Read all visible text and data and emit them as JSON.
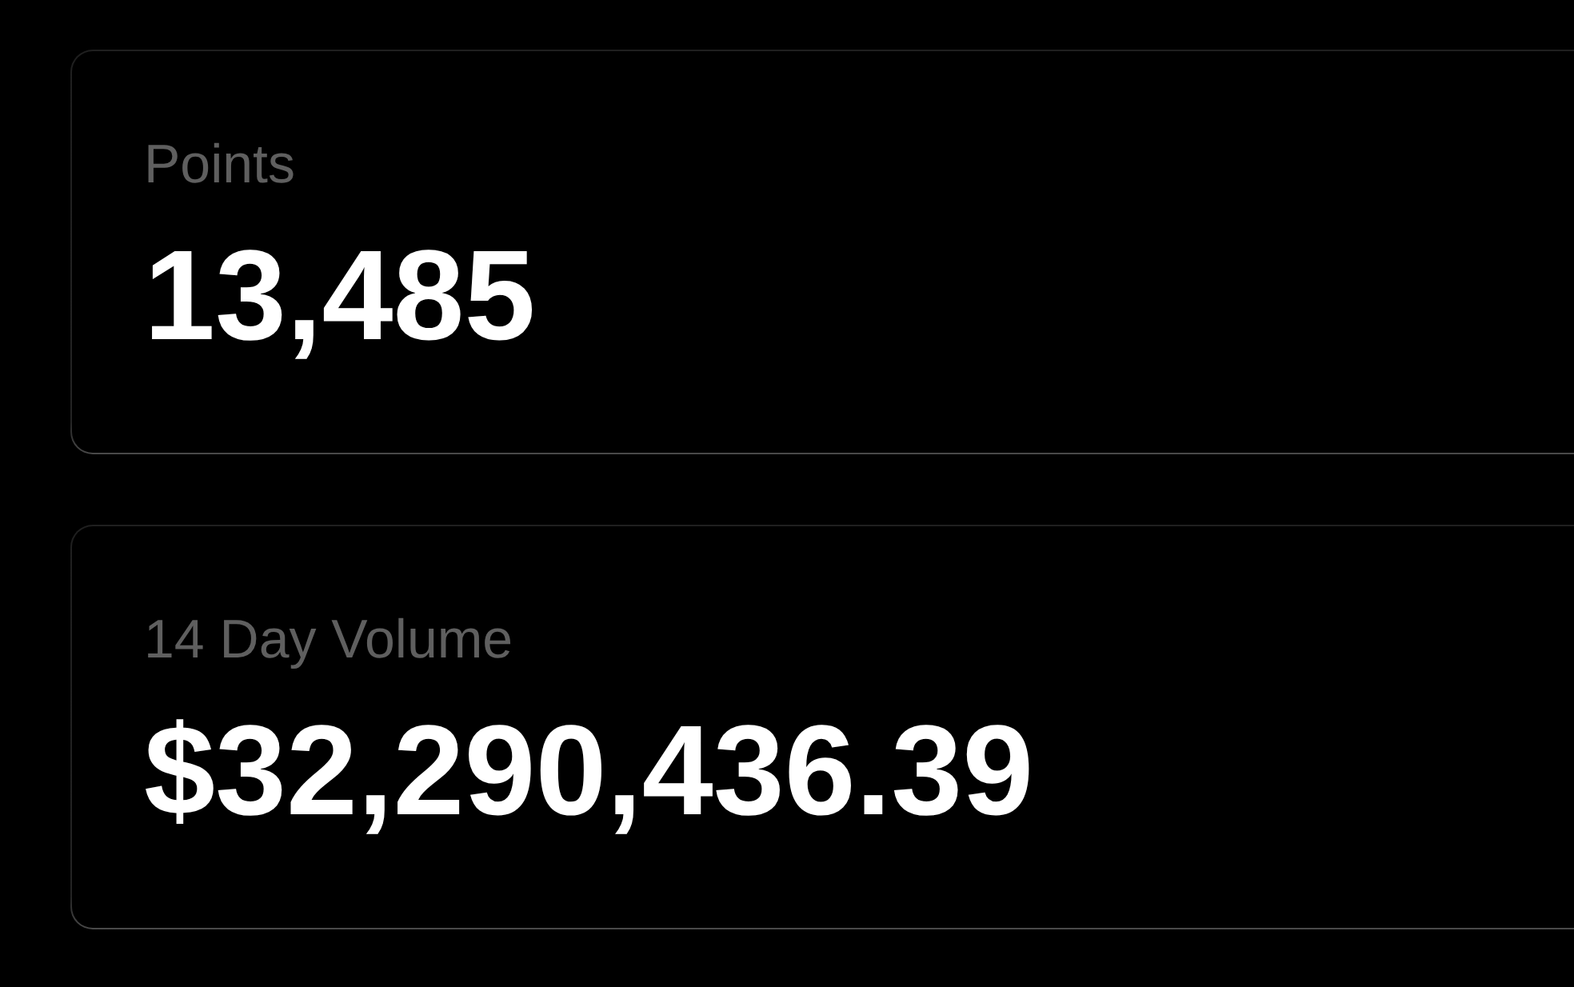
{
  "stats": [
    {
      "label": "Points",
      "value": "13,485"
    },
    {
      "label": "14 Day Volume",
      "value": "$32,290,436.39"
    }
  ]
}
